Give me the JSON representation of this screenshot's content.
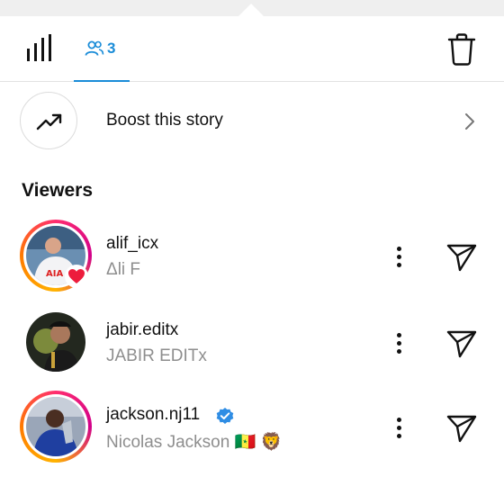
{
  "tabs": {
    "viewers_count": "3"
  },
  "boost": {
    "label": "Boost this story"
  },
  "viewers_heading": "Viewers",
  "viewers": [
    {
      "username": "alif_icx",
      "display_name": "Δli F",
      "verified": false,
      "liked": true
    },
    {
      "username": "jabir.editx",
      "display_name": "JABIR EDITx",
      "verified": false,
      "liked": false
    },
    {
      "username": "jackson.nj11",
      "display_name": "Nicolas Jackson 🇸🇳 🦁",
      "verified": true,
      "liked": false
    }
  ],
  "colors": {
    "accent": "#1a8cd8",
    "like": "#ed1c3c",
    "secondary_text": "#8e8e8e"
  }
}
